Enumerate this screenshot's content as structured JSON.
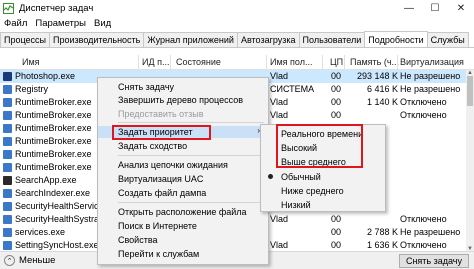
{
  "window": {
    "title": "Диспетчер задач",
    "controls": [
      "—",
      "☐",
      "✕"
    ]
  },
  "menubar": [
    "Файл",
    "Параметры",
    "Вид"
  ],
  "tabs": [
    "Процессы",
    "Производительность",
    "Журнал приложений",
    "Автозагрузка",
    "Пользователи",
    "Подробности",
    "Службы"
  ],
  "active_tab": "Подробности",
  "columns": {
    "name": "Имя",
    "pid": "ИД п...",
    "status": "Состояние",
    "user": "Имя пол...",
    "cpu": "ЦП",
    "memory": "Память (ч...",
    "virt": "Виртуализация"
  },
  "rows": [
    {
      "name": "Photoshop.exe",
      "user": "Vlad",
      "cpu": "00",
      "mem": "293 148 K",
      "virt": "Не разрешено",
      "selected": true,
      "icon": "#1a3a7a"
    },
    {
      "name": "Registry",
      "user": "СИСТЕМА",
      "cpu": "00",
      "mem": "6 416 K",
      "virt": "Не разрешено",
      "selected": false,
      "icon": "#3c78c8"
    },
    {
      "name": "RuntimeBroker.exe",
      "user": "Vlad",
      "cpu": "00",
      "mem": "1 140 K",
      "virt": "Отключено",
      "selected": false,
      "icon": "#3c78c8"
    },
    {
      "name": "RuntimeBroker.exe",
      "user": "Vlad",
      "cpu": "00",
      "mem": "",
      "virt": "Отключено",
      "selected": false,
      "icon": "#3c78c8"
    },
    {
      "name": "RuntimeBroker.exe",
      "user": "Vlad",
      "cpu": "",
      "mem": "",
      "virt": "",
      "selected": false,
      "icon": "#3c78c8"
    },
    {
      "name": "RuntimeBroker.exe",
      "user": "",
      "cpu": "",
      "mem": "",
      "virt": "",
      "selected": false,
      "icon": "#3c78c8"
    },
    {
      "name": "RuntimeBroker.exe",
      "user": "",
      "cpu": "",
      "mem": "",
      "virt": "",
      "selected": false,
      "icon": "#3c78c8"
    },
    {
      "name": "RuntimeBroker.exe",
      "user": "",
      "cpu": "",
      "mem": "",
      "virt": "",
      "selected": false,
      "icon": "#3c78c8"
    },
    {
      "name": "SearchApp.exe",
      "user": "",
      "cpu": "",
      "mem": "",
      "virt": "",
      "selected": false,
      "icon": "#2a2a2a"
    },
    {
      "name": "SearchIndexer.exe",
      "user": "",
      "cpu": "",
      "mem": "",
      "virt": "",
      "selected": false,
      "icon": "#3c78c8"
    },
    {
      "name": "SecurityHealthService.exe",
      "user": "",
      "cpu": "",
      "mem": "",
      "virt": "",
      "selected": false,
      "icon": "#3c78c8"
    },
    {
      "name": "SecurityHealthSystray.exe",
      "user": "Vlad",
      "cpu": "00",
      "mem": "",
      "virt": "Отключено",
      "selected": false,
      "icon": "#3c78c8"
    },
    {
      "name": "services.exe",
      "user": "",
      "cpu": "00",
      "mem": "2 788 K",
      "virt": "Не разрешено",
      "selected": false,
      "icon": "#3c78c8"
    },
    {
      "name": "SettingSyncHost.exe",
      "user": "Vlad",
      "cpu": "00",
      "mem": "1 636 K",
      "virt": "Отключено",
      "selected": false,
      "icon": "#3c78c8"
    }
  ],
  "context_menu": {
    "items": [
      {
        "label": "Снять задачу",
        "disabled": false
      },
      {
        "label": "Завершить дерево процессов",
        "disabled": false
      },
      {
        "label": "Предоставить отзыв",
        "disabled": true
      },
      {
        "label": "Задать приоритет",
        "disabled": false,
        "submenu": true
      },
      {
        "label": "Задать сходство",
        "disabled": false
      },
      {
        "label": "Анализ цепочки ожидания",
        "disabled": false
      },
      {
        "label": "Виртуализация UAC",
        "disabled": false
      },
      {
        "label": "Создать файл дампа",
        "disabled": false
      },
      {
        "label": "Открыть расположение файла",
        "disabled": false
      },
      {
        "label": "Поиск в Интернете",
        "disabled": false
      },
      {
        "label": "Свойства",
        "disabled": false
      },
      {
        "label": "Перейти к службам",
        "disabled": false
      }
    ]
  },
  "priority_submenu": {
    "items": [
      "Реального времени",
      "Высокий",
      "Выше среднего",
      "Обычный",
      "Ниже среднего",
      "Низкий"
    ],
    "selected": "Обычный"
  },
  "statusbar": {
    "less_label": "Меньше",
    "end_task_label": "Снять задачу"
  },
  "colors": {
    "selection": "#cce8ff",
    "highlight_box": "#e0161e"
  }
}
